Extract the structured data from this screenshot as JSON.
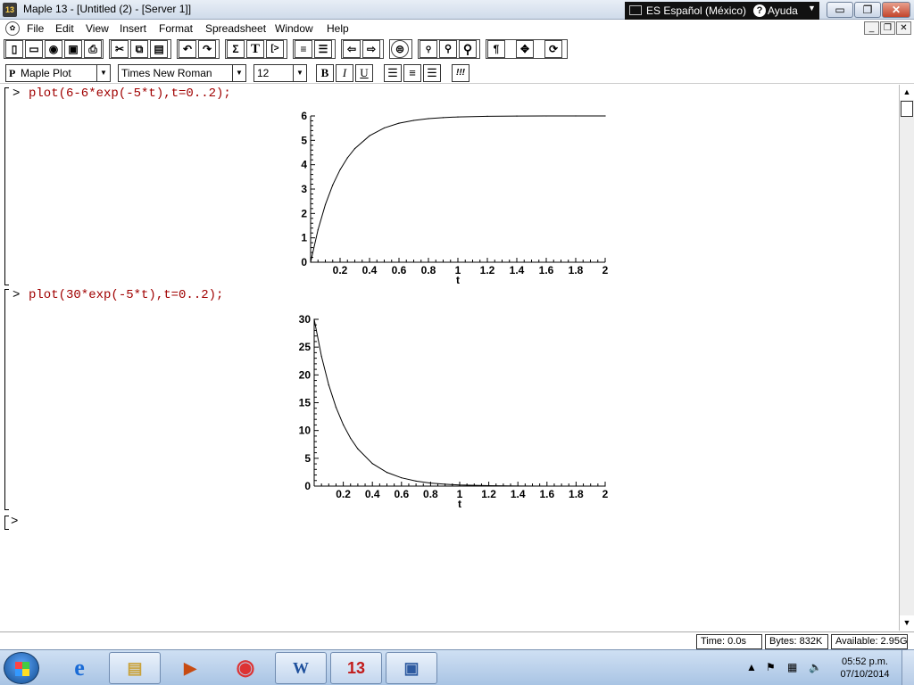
{
  "window": {
    "app_icon": "13",
    "title": "Maple 13 - [Untitled (2) - [Server 1]]",
    "language": "ES Español (México)",
    "help": "Ayuda",
    "minimize": "▭",
    "restore": "❐",
    "close": "✕"
  },
  "menu": {
    "items": [
      "File",
      "Edit",
      "View",
      "Insert",
      "Format",
      "Spreadsheet",
      "Window",
      "Help"
    ],
    "mdi_minimize": "_",
    "mdi_restore": "❐",
    "mdi_close": "✕"
  },
  "toolbar": {
    "icons": [
      "new-document-icon",
      "open-folder-icon",
      "open-url-icon",
      "save-icon",
      "print-icon",
      "cut-icon",
      "copy-icon",
      "paste-icon",
      "undo-icon",
      "redo-icon",
      "sigma-icon",
      "text-T-icon",
      "insert-prompt-icon",
      "execution-group-icon",
      "section-icon",
      "arrow-left-icon",
      "arrow-right-icon",
      "stop-icon",
      "zoom-small-icon",
      "zoom-medium-icon",
      "zoom-large-icon",
      "pilcrow-icon",
      "resize-arrows-icon",
      "restart-icon"
    ],
    "sigma": "Σ",
    "text_T": "T",
    "insert_prompt": "[>",
    "pilcrow": "¶",
    "arrow_left": "⇦",
    "arrow_right": "⇨"
  },
  "formatbar": {
    "style": "Maple Plot",
    "style_prefix": "P",
    "font": "Times New Roman",
    "size": "12",
    "bold": "B",
    "italic": "I",
    "underline": "U",
    "exclaim": "!!!"
  },
  "worksheet": {
    "prompt": ">",
    "cmd1": "plot(6-6*exp(-5*t),t=0..2);",
    "cmd2": "plot(30*exp(-5*t),t=0..2);",
    "empty_prompt": ">"
  },
  "chart_data": [
    {
      "type": "line",
      "function": "6-6*exp(-5*t)",
      "title": "",
      "xlabel": "t",
      "ylabel": "",
      "xlim": [
        0,
        2
      ],
      "ylim": [
        0,
        6
      ],
      "xticks": [
        "0.2",
        "0.4",
        "0.6",
        "0.8",
        "1",
        "1.2",
        "1.4",
        "1.6",
        "1.8",
        "2"
      ],
      "yticks": [
        "0",
        "1",
        "2",
        "3",
        "4",
        "5",
        "6"
      ],
      "x": [
        0,
        0.05,
        0.1,
        0.15,
        0.2,
        0.25,
        0.3,
        0.4,
        0.5,
        0.6,
        0.7,
        0.8,
        0.9,
        1.0,
        1.2,
        1.4,
        1.6,
        1.8,
        2.0
      ],
      "y": [
        0,
        1.327,
        2.361,
        3.167,
        3.793,
        4.281,
        4.661,
        5.188,
        5.508,
        5.701,
        5.818,
        5.89,
        5.933,
        5.96,
        5.985,
        5.995,
        5.998,
        5.999,
        6.0
      ]
    },
    {
      "type": "line",
      "function": "30*exp(-5*t)",
      "title": "",
      "xlabel": "t",
      "ylabel": "",
      "xlim": [
        0,
        2
      ],
      "ylim": [
        0,
        30
      ],
      "xticks": [
        "0.2",
        "0.4",
        "0.6",
        "0.8",
        "1",
        "1.2",
        "1.4",
        "1.6",
        "1.8",
        "2"
      ],
      "yticks": [
        "0",
        "5",
        "10",
        "15",
        "20",
        "25",
        "30"
      ],
      "x": [
        0,
        0.05,
        0.1,
        0.15,
        0.2,
        0.25,
        0.3,
        0.4,
        0.5,
        0.6,
        0.7,
        0.8,
        0.9,
        1.0,
        1.2,
        1.4,
        1.6,
        1.8,
        2.0
      ],
      "y": [
        30,
        23.364,
        18.196,
        14.171,
        11.036,
        8.595,
        6.694,
        4.06,
        2.463,
        1.494,
        0.906,
        0.549,
        0.333,
        0.202,
        0.074,
        0.027,
        0.01,
        0.004,
        0.001
      ]
    }
  ],
  "status": {
    "time": "Time:   0.0s",
    "bytes": "Bytes:  832K",
    "available": "Available:  2.95G"
  },
  "taskbar": {
    "apps": [
      "explorer-icon",
      "media-player-icon",
      "chrome-icon",
      "word-icon",
      "maple-icon",
      "photo-viewer-icon"
    ],
    "word_label": "W",
    "maple_label": "13",
    "clock_time": "05:52 p.m.",
    "clock_date": "07/10/2014"
  }
}
